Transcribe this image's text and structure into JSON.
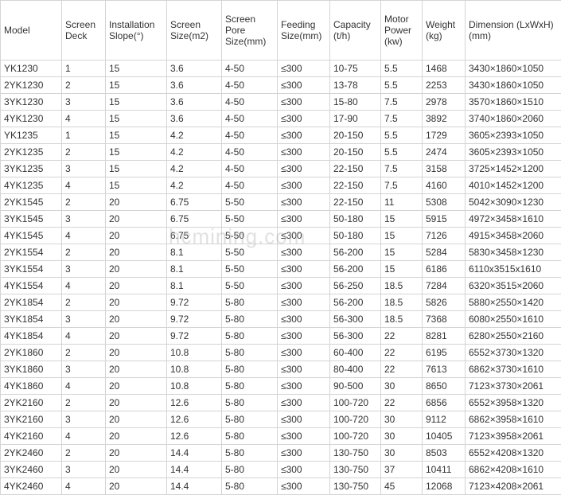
{
  "headers": [
    "Model",
    "Screen Deck",
    "Installation Slope(°)",
    "Screen Size(m2)",
    "Screen Pore Size(mm)",
    "Feeding Size(mm)",
    "Capacity (t/h)",
    "Motor Power (kw)",
    "Weight (kg)",
    "Dimension (LxWxH)(mm)"
  ],
  "rows": [
    [
      "YK1230",
      "1",
      "15",
      "3.6",
      "4-50",
      "≤300",
      "10-75",
      "5.5",
      "1468",
      "3430×1860×1050"
    ],
    [
      "2YK1230",
      "2",
      "15",
      "3.6",
      "4-50",
      "≤300",
      "13-78",
      "5.5",
      "2253",
      "3430×1860×1050"
    ],
    [
      "3YK1230",
      "3",
      "15",
      "3.6",
      "4-50",
      "≤300",
      "15-80",
      "7.5",
      "2978",
      "3570×1860×1510"
    ],
    [
      "4YK1230",
      "4",
      "15",
      "3.6",
      "4-50",
      "≤300",
      "17-90",
      "7.5",
      "3892",
      "3740×1860×2060"
    ],
    [
      "YK1235",
      "1",
      "15",
      "4.2",
      "4-50",
      "≤300",
      "20-150",
      "5.5",
      "1729",
      "3605×2393×1050"
    ],
    [
      "2YK1235",
      "2",
      "15",
      "4.2",
      "4-50",
      "≤300",
      "20-150",
      "5.5",
      "2474",
      "3605×2393×1050"
    ],
    [
      "3YK1235",
      "3",
      "15",
      "4.2",
      "4-50",
      "≤300",
      "22-150",
      "7.5",
      "3158",
      "3725×1452×1200"
    ],
    [
      "4YK1235",
      "4",
      "15",
      "4.2",
      "4-50",
      "≤300",
      "22-150",
      "7.5",
      "4160",
      "4010×1452×1200"
    ],
    [
      "2YK1545",
      "2",
      "20",
      "6.75",
      "5-50",
      "≤300",
      "22-150",
      "11",
      "5308",
      "5042×3090×1230"
    ],
    [
      "3YK1545",
      "3",
      "20",
      "6.75",
      "5-50",
      "≤300",
      "50-180",
      "15",
      "5915",
      "4972×3458×1610"
    ],
    [
      "4YK1545",
      "4",
      "20",
      "6.75",
      "5-50",
      "≤300",
      "50-180",
      "15",
      "7126",
      "4915×3458×2060"
    ],
    [
      "2YK1554",
      "2",
      "20",
      "8.1",
      "5-50",
      "≤300",
      "56-200",
      "15",
      "5284",
      "5830×3458×1230"
    ],
    [
      "3YK1554",
      "3",
      "20",
      "8.1",
      "5-50",
      "≤300",
      "56-200",
      "15",
      "6186",
      "6110x3515x1610"
    ],
    [
      "4YK1554",
      "4",
      "20",
      "8.1",
      "5-50",
      "≤300",
      "56-250",
      "18.5",
      "7284",
      "6320×3515×2060"
    ],
    [
      "2YK1854",
      "2",
      "20",
      "9.72",
      "5-80",
      "≤300",
      "56-200",
      "18.5",
      "5826",
      "5880×2550×1420"
    ],
    [
      "3YK1854",
      "3",
      "20",
      "9.72",
      "5-80",
      "≤300",
      "56-300",
      "18.5",
      "7368",
      "6080×2550×1610"
    ],
    [
      "4YK1854",
      "4",
      "20",
      "9.72",
      "5-80",
      "≤300",
      "56-300",
      "22",
      "8281",
      "6280×2550×2160"
    ],
    [
      "2YK1860",
      "2",
      "20",
      "10.8",
      "5-80",
      "≤300",
      "60-400",
      "22",
      "6195",
      "6552×3730×1320"
    ],
    [
      "3YK1860",
      "3",
      "20",
      "10.8",
      "5-80",
      "≤300",
      "80-400",
      "22",
      "7613",
      "6862×3730×1610"
    ],
    [
      "4YK1860",
      "4",
      "20",
      "10.8",
      "5-80",
      "≤300",
      "90-500",
      "30",
      "8650",
      "7123×3730×2061"
    ],
    [
      "2YK2160",
      "2",
      "20",
      "12.6",
      "5-80",
      "≤300",
      "100-720",
      "22",
      "6856",
      "6552×3958×1320"
    ],
    [
      "3YK2160",
      "3",
      "20",
      "12.6",
      "5-80",
      "≤300",
      "100-720",
      "30",
      "9112",
      "6862×3958×1610"
    ],
    [
      "4YK2160",
      "4",
      "20",
      "12.6",
      "5-80",
      "≤300",
      "100-720",
      "30",
      "10405",
      "7123×3958×2061"
    ],
    [
      "2YK2460",
      "2",
      "20",
      "14.4",
      "5-80",
      "≤300",
      "130-750",
      "30",
      "8503",
      "6552×4208×1320"
    ],
    [
      "3YK2460",
      "3",
      "20",
      "14.4",
      "5-80",
      "≤300",
      "130-750",
      "37",
      "10411",
      "6862×4208×1610"
    ],
    [
      "4YK2460",
      "4",
      "20",
      "14.4",
      "5-80",
      "≤300",
      "130-750",
      "45",
      "12068",
      "7123×4208×2061"
    ]
  ],
  "watermark": "hcmining.com"
}
